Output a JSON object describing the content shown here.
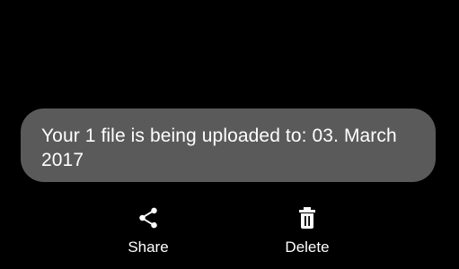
{
  "toast": {
    "message": "Your 1 file is being uploaded to: 03. March 2017"
  },
  "actions": [
    {
      "label": "Share",
      "icon": "share-icon"
    },
    {
      "label": "Delete",
      "icon": "trash-icon"
    }
  ],
  "colors": {
    "background": "#000000",
    "toast_background": "#5a5a5a",
    "text": "#ffffff"
  }
}
